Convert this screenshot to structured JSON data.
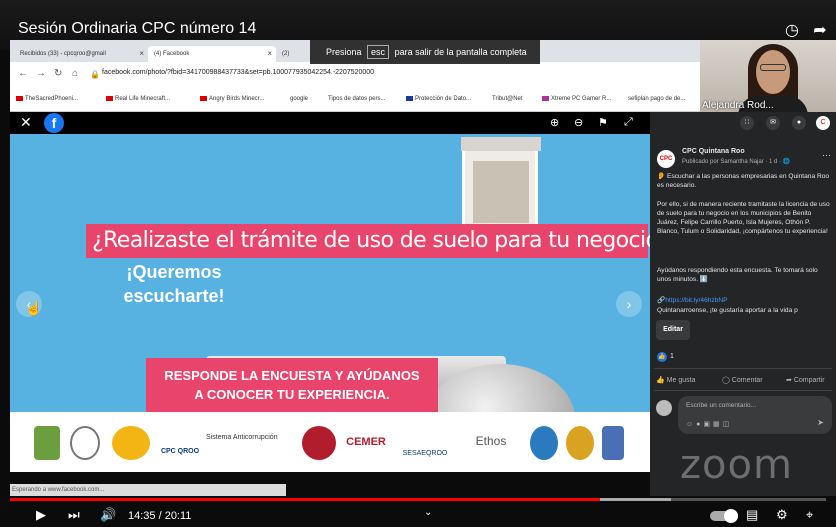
{
  "video": {
    "title": "Sesión Ordinaria CPC número 14",
    "time": "14:35 / 20:11",
    "progress": 0.723,
    "buffered": 0.81
  },
  "browser": {
    "tabs": [
      {
        "label": "Recibidos (33) - cpcqroo@gmail"
      },
      {
        "label": "(4) Facebook"
      },
      {
        "label": "(2)"
      }
    ],
    "url": "facebook.com/photo/?fbid=341700988437733&set=pb.100077935042254.-2207520000",
    "bookmarks": [
      "TheSacredPhoeni...",
      "Real Life Minecraft...",
      "Angry Birds Minecr...",
      "google",
      "Tipos de datos pers...",
      "Protección de Dato...",
      "Tribut@Net",
      "Xtreme PC Gamer R...",
      "sefiplan pago de de..."
    ],
    "status": "Esperando a www.facebook.com..."
  },
  "fullscreen_hint": {
    "before": "Presiona",
    "key": "esc",
    "after": "para salir de la pantalla completa"
  },
  "webcam": {
    "name": "Alejandra Rod..."
  },
  "photo": {
    "headline": "¿Realizaste el trámite de uso de suelo para tu negocio?",
    "sub_line1": "¡Queremos",
    "sub_line2": "escucharte!",
    "cta_line1": "RESPONDE LA ENCUESTA Y AYÚDANOS",
    "cta_line2": "A CONOCER TU EXPERIENCIA.",
    "logos": [
      "CPC QROO",
      "Sistema Anticorrupción",
      "CEMER",
      "SESAEQROO",
      "Ethos"
    ]
  },
  "post": {
    "page_name": "CPC Quintana Roo",
    "meta": "Publicado por Samantha Najar · 1 d · ",
    "p1": "👂 Escuchar a las personas empresarias en Quintana Roo es necesario.",
    "p2": "Por ello, si de manera reciente tramitaste la licencia de uso de suelo para tu negocio en los municipios de Benito Juárez, Felipe Carrillo Puerto, Isla Mujeres, Othón P. Blanco, Tulum o Solidaridad, ¡compártenos tu experiencia!",
    "p3": "Ayúdanos respondiendo esta encuesta. Te tomará solo unos minutos. ⬇️",
    "link": "https://bit.ly/46hzbNP",
    "hashtag": "Quintanarroense, ¡te gustaría aportar a la vida p",
    "edit": "Editar",
    "likes": "1",
    "like_btn": "Me gusta",
    "comment_btn": "Comentar",
    "share_btn": "Compartir",
    "comment_placeholder": "Escribe un comentario..."
  },
  "zoom_brand": "zoom",
  "icons": [
    "clock-icon",
    "share-icon",
    "close-icon",
    "facebook-logo",
    "zoom-in-icon",
    "zoom-out-icon",
    "tag-icon",
    "expand-icon",
    "play-icon",
    "next-icon",
    "volume-icon",
    "chevron-down-icon",
    "captions-icon",
    "settings-icon",
    "fullscreen-exit-icon"
  ]
}
